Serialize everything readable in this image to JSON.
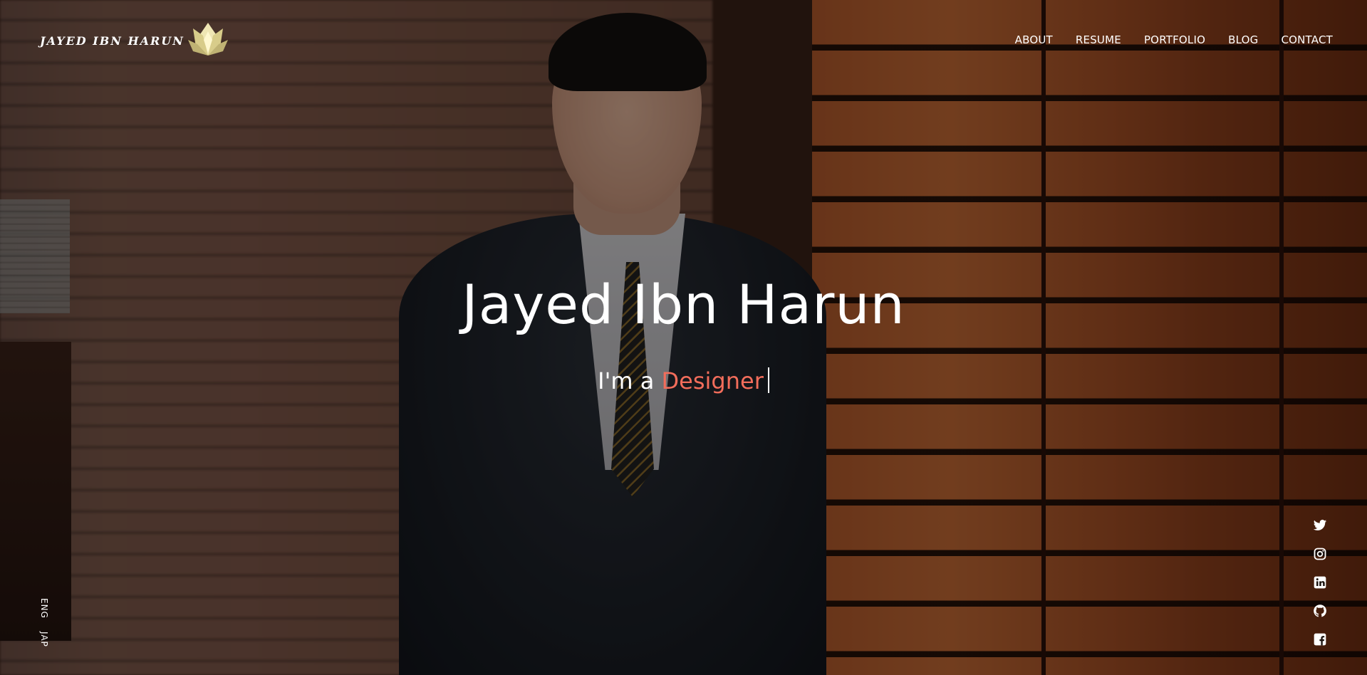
{
  "logo": {
    "text": "JAYED IBN HARUN",
    "mark": "lotus-logo-icon"
  },
  "nav": {
    "items": [
      {
        "label": "ABOUT"
      },
      {
        "label": "RESUME"
      },
      {
        "label": "PORTFOLIO"
      },
      {
        "label": "BLOG"
      },
      {
        "label": "CONTACT"
      }
    ]
  },
  "hero": {
    "name": "Jayed Ibn Harun",
    "tagline_prefix": "I'm a",
    "tagline_role": "Designer"
  },
  "language": {
    "items": [
      {
        "label": "ENG"
      },
      {
        "label": "JAP"
      }
    ]
  },
  "social": {
    "icons": [
      "twitter-icon",
      "instagram-icon",
      "linkedin-icon",
      "github-icon",
      "facebook-icon"
    ]
  },
  "colors": {
    "accent": "#f26d5b",
    "text": "#ffffff",
    "logo_gold": "#e9dca0"
  }
}
